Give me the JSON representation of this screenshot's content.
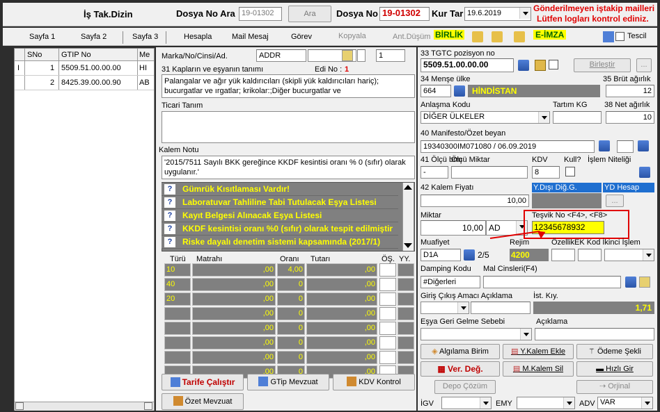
{
  "header": {
    "is_tak_dizin": "İş Tak.Dizin",
    "dosya_no_ara_label": "Dosya No Ara",
    "dosya_no_ara_value": "19-01302",
    "ara_button": "Ara",
    "dosya_no_label": "Dosya No",
    "dosya_no_value": "19-01302",
    "kur_tar_label": "Kur Tar",
    "kur_tar_value": "19.6.2019",
    "alert_line1": "Gönderilmeyen iştakip mailleri",
    "alert_line2": "Lütfen logları kontrol ediniz."
  },
  "menu": {
    "sayfa1": "Sayfa 1",
    "sayfa2": "Sayfa 2",
    "sayfa3": "Sayfa 3",
    "hesapla": "Hesapla",
    "mail_mesaj": "Mail Mesaj",
    "gorev": "Görev",
    "kopyala": "Kopyala",
    "ant_dusum": "Ant.Düşüm",
    "birlik": "BİRLİK",
    "e_imza": "E-İMZA",
    "tescil": "Tescil"
  },
  "item_table": {
    "columns": [
      "SNo",
      "GTIP No",
      "Me"
    ],
    "rows": [
      {
        "marker": "I",
        "sno": "1",
        "gtip": "5509.51.00.00.00",
        "me": "HI"
      },
      {
        "marker": "",
        "sno": "2",
        "gtip": "8425.39.00.00.90",
        "me": "AB"
      }
    ]
  },
  "middle": {
    "marka_label": "Marka/No/Cinsi/Ad.",
    "marka_value": "ADDR",
    "marka_num": "1",
    "kaplar_label": "31 Kapların ve eşyanın tanımı",
    "edi_no_label": "Edi No :",
    "edi_no_value": "1",
    "kaplar_text": "Palangalar ve ağır yük kaldırıcıları (skipli yük kaldırıcıları hariç); bucurgatlar ve ırgatlar; krikolar:;Diğer bucurgatlar ve",
    "ticari_tanim_label": "Ticari Tanım",
    "kalem_notu_label": "Kalem Notu",
    "kalem_notu_text": "'2015/7511 Sayılı BKK gereğince KKDF kesintisi oranı % 0 (sıfır) olarak uygulanır.'",
    "warnings": [
      "Gümrük Kısıtlaması Vardır!",
      "Laboratuvar Tahliline Tabi Tutulacak Eşya Listesi",
      "Kayıt Belgesi Alınacak Eşya Listesi",
      "KKDF kesintisi oranı %0 (sıfır) olarak tespit edilmiştir",
      "Riske dayalı denetim sistemi kapsamında (2017/1)"
    ],
    "tax_headers": [
      "Türü",
      "Matrahı",
      "Oranı",
      "Tutarı",
      "ÖŞ.",
      "YY."
    ],
    "tax_rows": [
      {
        "turu": "10",
        "matrah": ",00",
        "oran": "4,00",
        "tutar": ",00"
      },
      {
        "turu": "40",
        "matrah": ",00",
        "oran": "0",
        "tutar": ",00"
      },
      {
        "turu": "20",
        "matrah": ",00",
        "oran": "0",
        "tutar": ",00"
      },
      {
        "turu": "",
        "matrah": ",00",
        "oran": "0",
        "tutar": ",00"
      },
      {
        "turu": "",
        "matrah": ",00",
        "oran": "0",
        "tutar": ",00"
      },
      {
        "turu": "",
        "matrah": ",00",
        "oran": "0",
        "tutar": ",00"
      },
      {
        "turu": "",
        "matrah": ",00",
        "oran": "0",
        "tutar": ",00"
      },
      {
        "turu": "",
        "matrah": ",00",
        "oran": "0",
        "tutar": ",00"
      }
    ],
    "tarife_calistir": "Tarife Çalıştır",
    "gtip_mevzuat": "GTip Mevzuat",
    "kdv_kontrol": "KDV Kontrol",
    "ozet_mevzuat": "Özet Mevzuat"
  },
  "right": {
    "tgtc_label": "33 TGTC pozisyon no",
    "tgtc_value": "5509.51.00.00.00",
    "birlestir": "Birleştir",
    "mense_label": "34 Menşe ülke",
    "mense_code": "664",
    "mense_name": "HİNDİSTAN",
    "brut_label": "35 Brüt ağırlık",
    "brut_value": "12",
    "anlasma_label": "Anlaşma Kodu",
    "anlasma_value": "DİĞER ÜLKELER",
    "tartim_label": "Tartım KG",
    "net_label": "38 Net ağırlık",
    "net_value": "10",
    "manifesto_label": "40 Manifesto/Özet beyan",
    "manifesto_value": "19340300IM071080 / 06.09.2019",
    "olcu_label": "41 Ölçü brm",
    "olcu_miktar_label": "Ölçü Miktar",
    "kdv_label": "KDV",
    "kdv_value": "8",
    "kull_label": "Kull?",
    "islem_label": "İşlem Niteliği",
    "olcu_value": "-",
    "kalem_fiyati_label": "42 Kalem Fiyatı",
    "kalem_fiyati_value": "10,00",
    "ydisi_label": "Y.Dışı Diğ.G.",
    "yd_hesap_label": "YD Hesap",
    "miktar_label": "Miktar",
    "miktar_value": "10,00",
    "miktar_unit": "AD",
    "tesvik_label": "Teşvik No <F4>, <F8>",
    "tesvik_value": "12345678932",
    "muafiyet_label": "Muafiyet",
    "rejim_label": "Rejim",
    "ozellik_label": "ÖzellikEK Kod İkinci İşlem",
    "muafiyet_value": "D1A",
    "page_indicator": "2/5",
    "rejim_value": "4200",
    "damping_label": "Damping Kodu",
    "mal_cinsleri_label": "Mal Cinsleri(F4)",
    "damping_value": "#Diğerleri",
    "giris_label": "Giriş Çıkış Amacı Açıklama",
    "ist_kiy_label": "İst. Kıy.",
    "ist_kiy_value": "1,71",
    "esya_geri_label": "Eşya Geri Gelme Sebebi",
    "aciklama_label": "Açıklama",
    "algilama_birim": "Algılama Birim",
    "y_kalem_ekle": "Y.Kalem Ekle",
    "odeme_sekli": "Ödeme Şekli",
    "ver_deg": "Ver. Değ.",
    "m_kalem_sil": "M.Kalem Sil",
    "hizli_gir": "Hızlı Gir",
    "depo_cozum": "Depo Çözüm",
    "orjinal": "Orjinal",
    "igv_label": "İGV",
    "emy_label": "EMY",
    "adv_label": "ADV",
    "adv_value": "VAR"
  }
}
